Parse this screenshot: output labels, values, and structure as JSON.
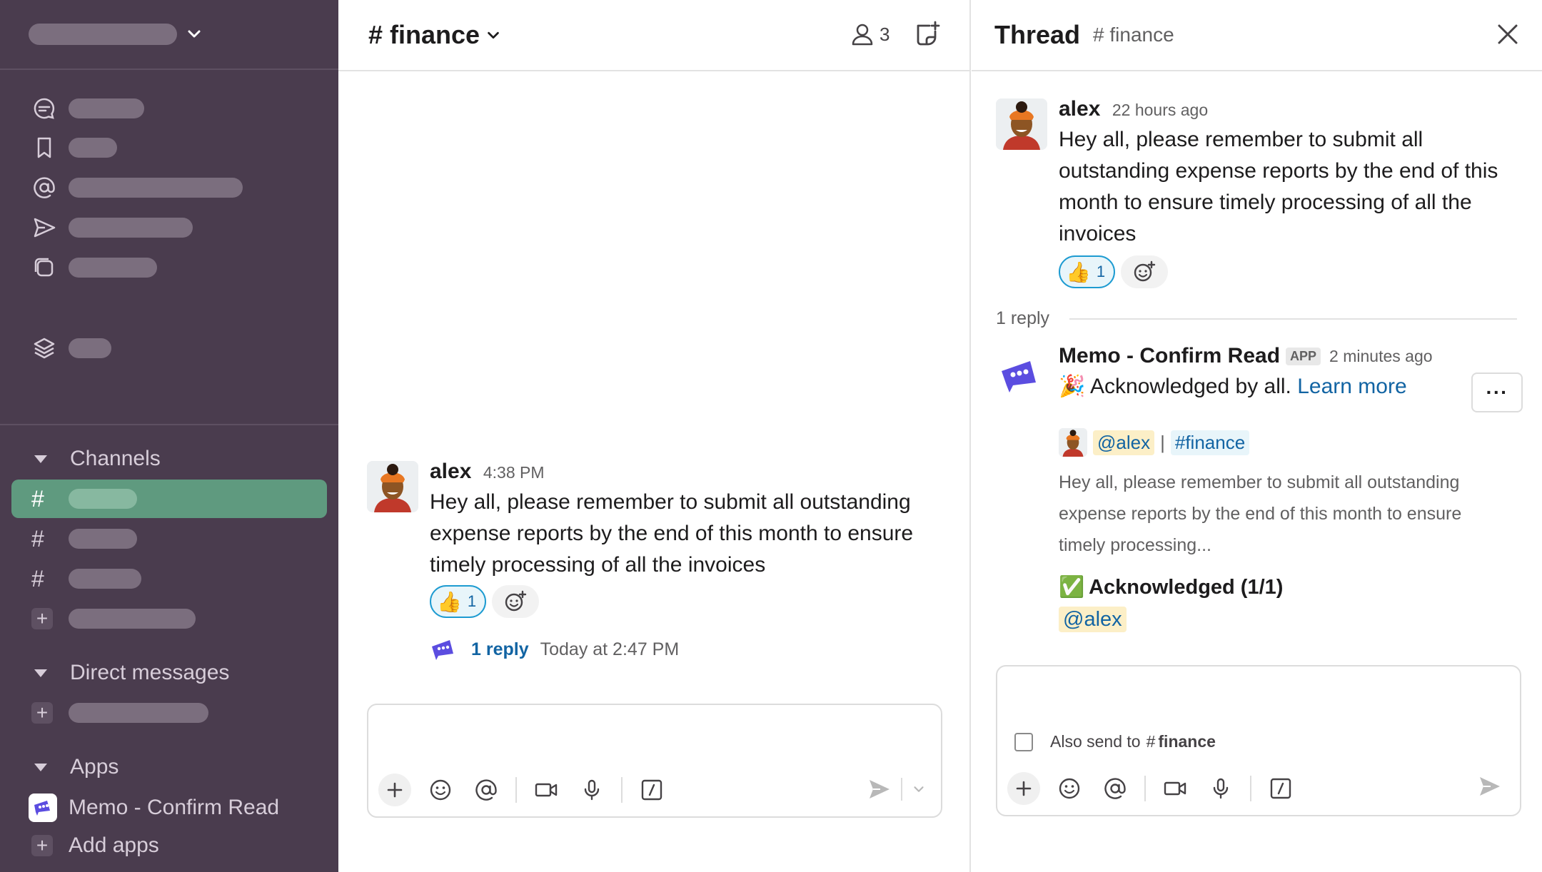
{
  "sidebar": {
    "sections": {
      "channels": "Channels",
      "direct_messages": "Direct messages",
      "apps": "Apps"
    },
    "app_item": "Memo - Confirm Read",
    "add_apps": "Add apps",
    "plus_glyph": "+",
    "hash_glyph": "#"
  },
  "channel": {
    "title": "# finance",
    "member_count": "3",
    "message": {
      "sender": "alex",
      "time": "4:38 PM",
      "text": "Hey all, please remember to submit all outstanding expense reports by the end of this month to ensure timely processing of all the invoices",
      "reaction_emoji": "👍",
      "reaction_count": "1",
      "reply_count": "1 reply",
      "reply_time": "Today at 2:47 PM"
    }
  },
  "thread": {
    "title": "Thread",
    "channel": "# finance",
    "parent": {
      "sender": "alex",
      "time": "22 hours ago",
      "text": "Hey all, please remember to submit all outstanding expense reports by the end of this month to ensure timely processing of all the invoices",
      "reaction_emoji": "👍",
      "reaction_count": "1"
    },
    "reply_count": "1 reply",
    "reply": {
      "sender": "Memo - Confirm Read",
      "badge": "APP",
      "time": "2 minutes ago",
      "party_emoji": "🎉",
      "ack_text": "Acknowledged by all.",
      "learn_more": "Learn more",
      "mention": "@alex",
      "separator": "|",
      "channel_link": "#finance",
      "quote": "Hey all, please remember to submit all outstanding expense reports by the end of this month to ensure timely processing...",
      "check_emoji": "✅",
      "ack_summary": "Acknowledged (1/1)",
      "ack_user": "@alex",
      "more_label": "···"
    },
    "composer": {
      "also_send_prefix": "Also send to",
      "also_send_hash": "#",
      "also_send_channel": "finance"
    }
  },
  "colors": {
    "sidebar_bg": "#4a3c4e",
    "active_channel": "#5f9a7f",
    "link": "#1264a3",
    "mention_bg": "#fcefc7"
  }
}
